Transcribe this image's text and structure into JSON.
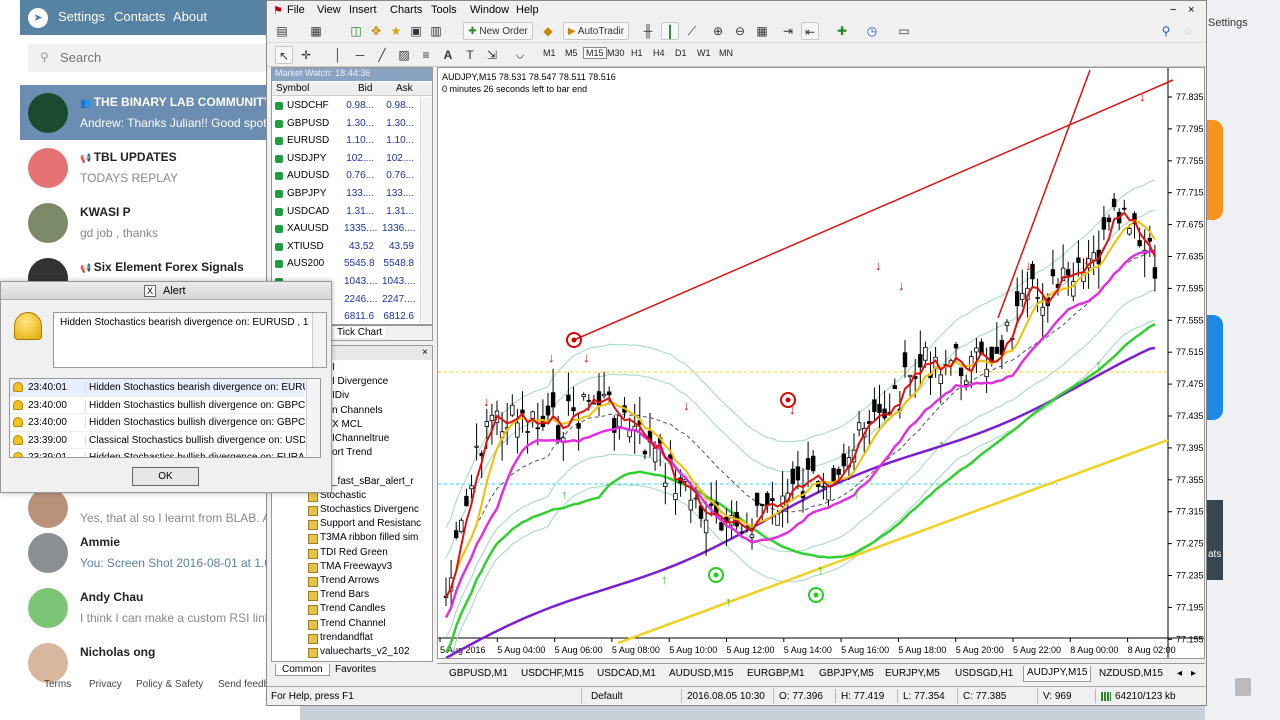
{
  "telegram": {
    "nav": [
      "Settings",
      "Contacts",
      "About"
    ],
    "search_placeholder": "Search",
    "chats": [
      {
        "name": "THE BINARY LAB COMMUNITY",
        "message": "Andrew: Thanks Julian!! Good spot",
        "avatar_color": "#1b4a2f",
        "selected": true,
        "icon": "group-icon"
      },
      {
        "name": "TBL UPDATES",
        "message": "TODAYS REPLAY",
        "avatar_color": "#e57373",
        "icon": "megaphone-icon"
      },
      {
        "name": "KWASI P",
        "message": "gd job , thanks",
        "avatar_color": "#7d8a6a"
      },
      {
        "name": "Six Element Forex Signals",
        "message": "",
        "avatar_color": "#333333",
        "icon": "megaphone-icon"
      },
      {
        "name": "",
        "message": "Yes, that al so I learnt from BLAB. A",
        "avatar_color": "#b9927a"
      },
      {
        "name": "Ammie",
        "message": "You: Screen Shot 2016-08-01 at 1.0",
        "avatar_color": "#8a8f93"
      },
      {
        "name": "Andy Chau",
        "message": "I think I can make a custom RSI link",
        "avatar_color": "#7cc576"
      },
      {
        "name": "Nicholas ong",
        "message": "",
        "avatar_color": "#d8b79f"
      }
    ],
    "footer": [
      "Terms",
      "Privacy",
      "Policy & Safety",
      "Send feedb"
    ]
  },
  "right_bg": {
    "settings_label": "Settings",
    "label_ats": "ats"
  },
  "mt4": {
    "menu": [
      "File",
      "View",
      "Insert",
      "Charts",
      "Tools",
      "Window",
      "Help"
    ],
    "toolbar": {
      "new_order": "New Order",
      "autotrading": "AutoTradir"
    },
    "timeframes": [
      "M1",
      "M5",
      "M15",
      "M30",
      "H1",
      "H4",
      "D1",
      "W1",
      "MN"
    ],
    "selected_timeframe": "M15",
    "market_watch": {
      "title": "Market Watch: 18:44:36",
      "headers": [
        "Symbol",
        "Bid",
        "Ask"
      ],
      "rows": [
        {
          "symbol": "USDCHF",
          "bid": "0.98...",
          "ask": "0.98..."
        },
        {
          "symbol": "GBPUSD",
          "bid": "1.30...",
          "ask": "1.30..."
        },
        {
          "symbol": "EURUSD",
          "bid": "1.10...",
          "ask": "1.10..."
        },
        {
          "symbol": "USDJPY",
          "bid": "102....",
          "ask": "102...."
        },
        {
          "symbol": "AUDUSD",
          "bid": "0.76...",
          "ask": "0.76..."
        },
        {
          "symbol": "GBPJPY",
          "bid": "133....",
          "ask": "133...."
        },
        {
          "symbol": "USDCAD",
          "bid": "1.31...",
          "ask": "1.31..."
        },
        {
          "symbol": "XAUUSD",
          "bid": "1335....",
          "ask": "1336...."
        },
        {
          "symbol": "XTIUSD",
          "bid": "43.52",
          "ask": "43.59"
        },
        {
          "symbol": "AUS200",
          "bid": "5545.8",
          "ask": "5548.8"
        },
        {
          "symbol": "",
          "bid": "1043....",
          "ask": "1043...."
        },
        {
          "symbol": "",
          "bid": "2246....",
          "ask": "2247...."
        },
        {
          "symbol": "",
          "bid": "6811.6",
          "ask": "6812.6"
        }
      ],
      "tab": "Tick Chart"
    },
    "navigator": {
      "items": [
        "I",
        "I Divergence",
        "IDiv",
        "n Channels",
        "X MCL",
        "IChanneltrue",
        "ort Trend",
        "",
        "_fast_sBar_alert_r",
        "Stochastic",
        "Stochastics Divergenc",
        "Support and Resistanc",
        "T3MA ribbon filled sim",
        "TDI Red Green",
        "TMA Freewayv3",
        "Trend Arrows",
        "Trend Bars",
        "Trend Candles",
        "Trend Channel",
        "trendandflat",
        "valuecharts_v2_102"
      ],
      "tabs": [
        "Common",
        "Favorites"
      ]
    },
    "chart": {
      "header": "AUDJPY,M15  78.531 78.547 78.511 78.516",
      "subheader": "0 minutes 26 seconds left to bar end",
      "price_labels": [
        "77.835",
        "77.795",
        "77.755",
        "77.715",
        "77.675",
        "77.635",
        "77.595",
        "77.555",
        "77.515",
        "77.475",
        "77.435",
        "77.395",
        "77.355",
        "77.315",
        "77.275",
        "77.235",
        "77.195",
        "77.155"
      ],
      "time_labels": [
        "5 Aug 2016",
        "5 Aug 04:00",
        "5 Aug 06:00",
        "5 Aug 08:00",
        "5 Aug 10:00",
        "5 Aug 12:00",
        "5 Aug 14:00",
        "5 Aug 16:00",
        "5 Aug 18:00",
        "5 Aug 20:00",
        "5 Aug 22:00",
        "8 Aug 00:00",
        "8 Aug 02:00"
      ],
      "colors": {
        "main_ma": "#e01010",
        "fast_ma": "#f0c000",
        "ma_magenta": "#e030e0",
        "ma_green": "#30d030",
        "ma_purple": "#7a1fd0",
        "ma_yellow": "#f0d020",
        "bands": "#9fd8c0",
        "trendline": "#dd1111"
      }
    },
    "symbol_tabs": [
      "GBPUSD,M1",
      "USDCHF,M15",
      "USDCAD,M1",
      "AUDUSD,M15",
      "EURGBP,M1",
      "GBPJPY,M5",
      "EURJPY,M5",
      "USDSGD,H1",
      "AUDJPY,M15",
      "NZDUSD,M15"
    ],
    "selected_symbol_tab": "AUDJPY,M15",
    "status": {
      "help": "For Help, press F1",
      "profile": "Default",
      "datetime": "2016.08.05 10:30",
      "open": "O: 77.396",
      "high": "H: 77.419",
      "low": "L: 77.354",
      "close": "C: 77.385",
      "volume": "V: 969",
      "traffic": "64210/123 kb"
    }
  },
  "alert": {
    "title": "Alert",
    "message": "Hidden Stochastics bearish divergence on: EURUSD , 1 min",
    "rows": [
      {
        "time": "23:40:01",
        "text": "Hidden Stochastics bearish divergence on: EURU..."
      },
      {
        "time": "23:40:00",
        "text": "Hidden Stochastics bullish divergence on: GBPCH..."
      },
      {
        "time": "23:40:00",
        "text": "Hidden Stochastics bullish divergence on: GBPCH..."
      },
      {
        "time": "23:39:00",
        "text": "Classical Stochastics bullish divergence on: USDC..."
      },
      {
        "time": "23:39:01",
        "text": "Hidden Stochastics bullish divergence on: EURAU..."
      }
    ],
    "ok_label": "OK"
  }
}
